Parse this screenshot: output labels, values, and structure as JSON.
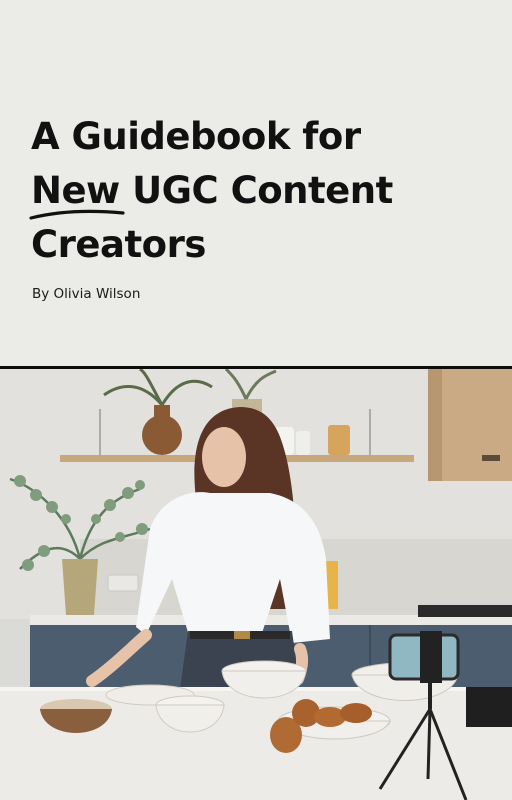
{
  "cover": {
    "title_lines": [
      "A Guidebook for",
      "New",
      " UGC Content",
      "Creators"
    ],
    "author": "By Olivia Wilson"
  },
  "photo": {
    "description_icon": "kitchen-photo",
    "colors": {
      "background": "#ebebe8",
      "divider": "#0d0d0d",
      "wall": "#dcdcd8",
      "cabinet": "#4a5b6b",
      "counter": "#ecebe8",
      "shelf": "#c9a77d"
    }
  }
}
